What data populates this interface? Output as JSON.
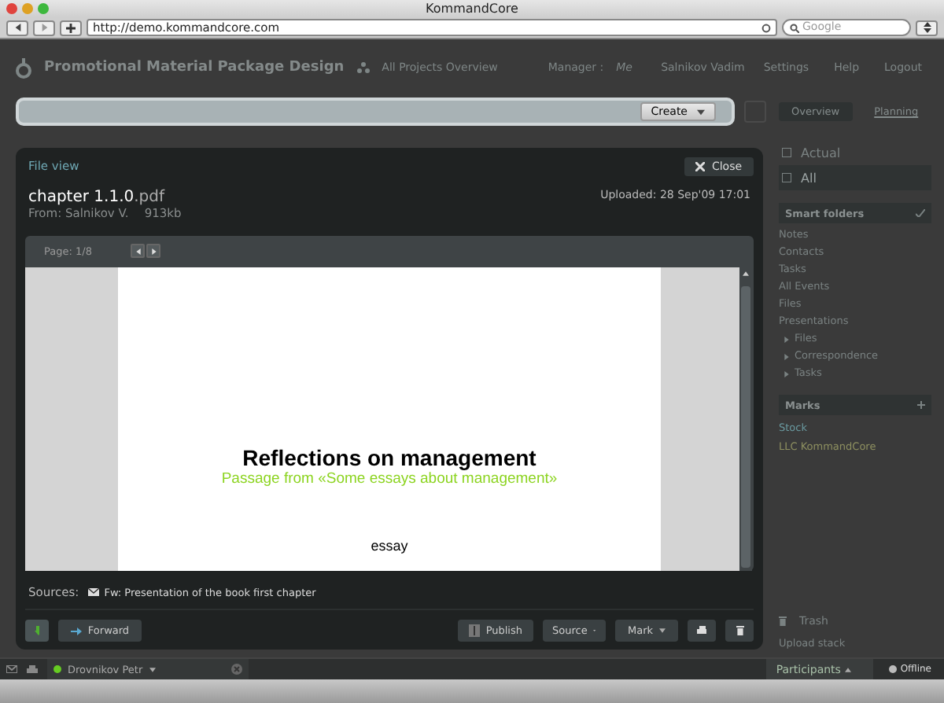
{
  "window": {
    "title": "KommandCore"
  },
  "browser": {
    "url": "http://demo.kommandcore.com",
    "search_placeholder": "Google"
  },
  "header": {
    "project": "Promotional Material Package Design",
    "overview_link": "All Projects Overview",
    "manager_label": "Manager :",
    "manager": "Me",
    "user": "Salnikov Vadim",
    "menu": [
      "Settings",
      "Help",
      "Logout"
    ]
  },
  "command_bar": {
    "create": "Create"
  },
  "view_tabs": [
    {
      "label": "Overview",
      "selected": true
    },
    {
      "label": "Planning",
      "selected": false
    }
  ],
  "sidebar": {
    "filters": [
      {
        "label": "Actual",
        "selected": false
      },
      {
        "label": "All",
        "selected": true
      }
    ],
    "smart_folders": {
      "title": "Smart folders",
      "items": [
        {
          "label": "Notes",
          "kind": "link"
        },
        {
          "label": "Contacts",
          "kind": "link"
        },
        {
          "label": "Tasks",
          "kind": "link"
        },
        {
          "label": "All Events",
          "kind": "link"
        },
        {
          "label": "Files",
          "kind": "link"
        },
        {
          "label": "Presentations",
          "kind": "link"
        },
        {
          "label": "Files",
          "kind": "folder",
          "expanded": false
        },
        {
          "label": "Correspondence",
          "kind": "folder",
          "expanded": false
        },
        {
          "label": "Tasks",
          "kind": "folder",
          "expanded": false
        }
      ]
    },
    "marks": {
      "title": "Marks",
      "items": [
        {
          "label": "Stock",
          "color": "#6a9aa0"
        },
        {
          "label": "LLC KommandCore",
          "color": "#8e9060"
        }
      ]
    },
    "trash": "Trash",
    "upload": "Upload stack"
  },
  "file_view": {
    "title": "File view",
    "close": "Close",
    "file_name": "chapter 1.1.0",
    "file_ext": ".pdf",
    "from": "From: Salnikov V.",
    "size": "913kb",
    "uploaded": "Uploaded: 28 Sep'09 17:01",
    "page": "Page: 1/8",
    "document": {
      "title": "Reflections on management",
      "subtitle": "Passage from «Some essays about management»",
      "body": "essay"
    },
    "sources_label": "Sources:",
    "source": "Fw: Presentation of the book first chapter",
    "actions": {
      "forward": "Forward",
      "publish": "Publish",
      "source": "Source",
      "mark": "Mark"
    }
  },
  "bottom_bar": {
    "contact": {
      "name": "Drovnikov Petr",
      "online": true
    },
    "participants": "Participants",
    "status": "Offline"
  }
}
